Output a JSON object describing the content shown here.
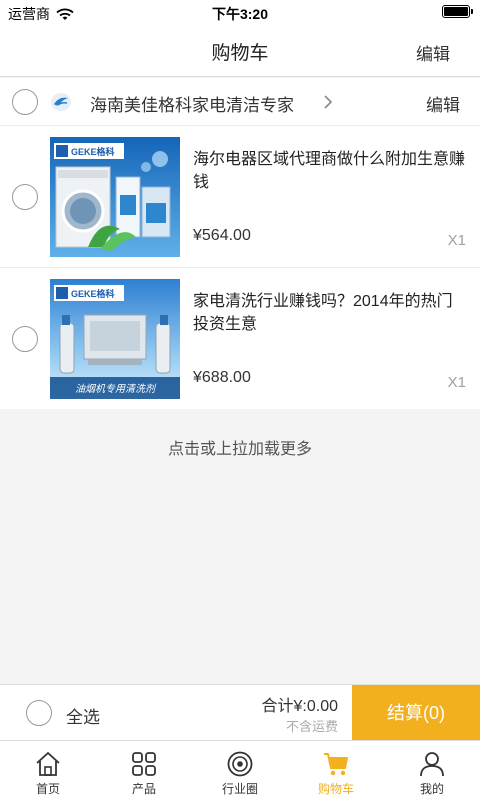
{
  "status_bar": {
    "carrier": "运营商",
    "time": "下午3:20"
  },
  "nav": {
    "title": "购物车",
    "edit_label": "编辑"
  },
  "shop": {
    "name": "海南美佳格科家电清洁专家",
    "edit_label": "编辑",
    "logo_icon": "bird-logo-icon"
  },
  "cart_items": [
    {
      "name": "海尔电器区域代理商做什么附加生意赚钱",
      "price": "¥564.00",
      "quantity": "X1",
      "image_brand": "GEKE格科"
    },
    {
      "name": "家电清洗行业赚钱吗？2014年的热门投资生意",
      "price": "¥688.00",
      "quantity": "X1",
      "image_brand": "GEKE格科",
      "image_caption": "油烟机专用清洗剂"
    }
  ],
  "load_more": "点击或上拉加载更多",
  "checkout": {
    "select_all_label": "全选",
    "total_label": "合计¥:0.00",
    "shipping_note": "不含运费",
    "pay_button": "结算(0)"
  },
  "tabs": [
    {
      "label": "首页",
      "icon": "home-icon"
    },
    {
      "label": "产品",
      "icon": "grid-icon"
    },
    {
      "label": "行业圈",
      "icon": "circle-icon"
    },
    {
      "label": "购物车",
      "icon": "cart-icon",
      "active": true
    },
    {
      "label": "我的",
      "icon": "user-icon"
    }
  ],
  "colors": {
    "accent": "#f2b01e",
    "background": "#f4f4f4"
  }
}
